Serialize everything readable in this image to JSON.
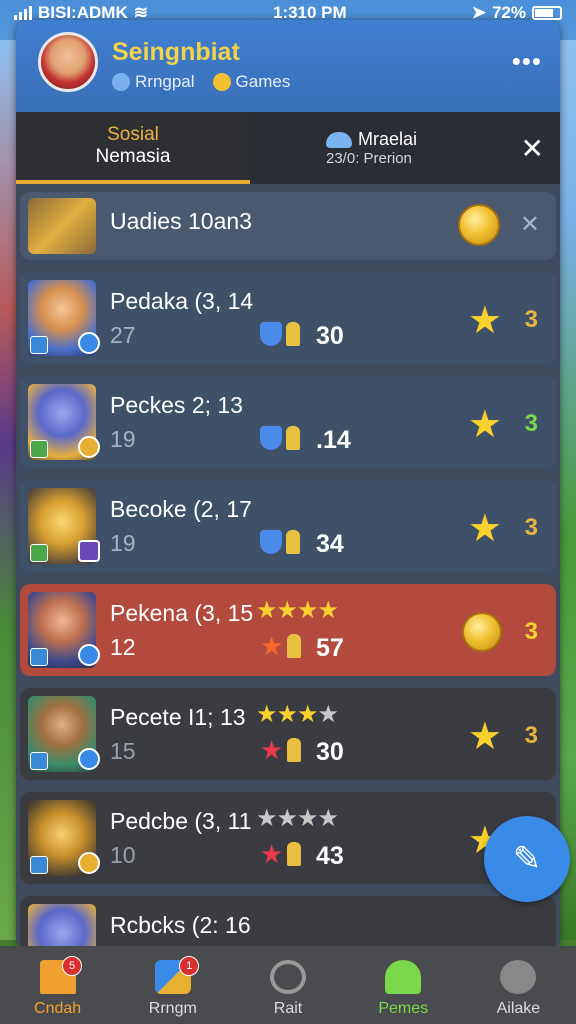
{
  "status": {
    "carrier": "BISI:ADMK",
    "time": "1:310 PM",
    "battery": "72%"
  },
  "header": {
    "title": "Seingnbiat",
    "sub1": "Rrngpal",
    "sub2": "Games",
    "more_icon": "ellipsis-icon"
  },
  "tabs": {
    "left": {
      "line1": "Sosial",
      "line2": "Nemasia"
    },
    "right": {
      "line1": "Mraelai",
      "line2": "23/0: Prerion"
    }
  },
  "banner": {
    "title": "Uadies 10an3"
  },
  "rows": [
    {
      "name": "Pedaka (3, 14",
      "sub": "27",
      "score": "30",
      "rank": "3",
      "rank_color": "#e8b440"
    },
    {
      "name": "Peckes 2; 13",
      "sub": "19",
      "score": ".14",
      "rank": "3",
      "rank_color": "#7ad84a"
    },
    {
      "name": "Becoke (2, 17",
      "sub": "19",
      "score": "34",
      "rank": "3",
      "rank_color": "#e8b440"
    },
    {
      "name": "Pekena (3, 15",
      "sub": "12",
      "score": "57",
      "rank": "3",
      "rank_color": "#f8d030"
    },
    {
      "name": "Pecete I1; 13",
      "sub": "15",
      "score": "30",
      "rank": "3",
      "rank_color": "#e8b440"
    },
    {
      "name": "Pedcbe (3, 11",
      "sub": "10",
      "score": "43",
      "rank": "",
      "rank_color": "#e8b440"
    },
    {
      "name": "Rcbcks (2: 16",
      "sub": "",
      "score": "",
      "rank": "",
      "rank_color": "#e8b440"
    }
  ],
  "nav": [
    {
      "label": "Cndah",
      "badge": "5"
    },
    {
      "label": "Rrngm",
      "badge": "1"
    },
    {
      "label": "Rait",
      "badge": ""
    },
    {
      "label": "Pemes",
      "badge": ""
    },
    {
      "label": "Ailake",
      "badge": ""
    }
  ]
}
